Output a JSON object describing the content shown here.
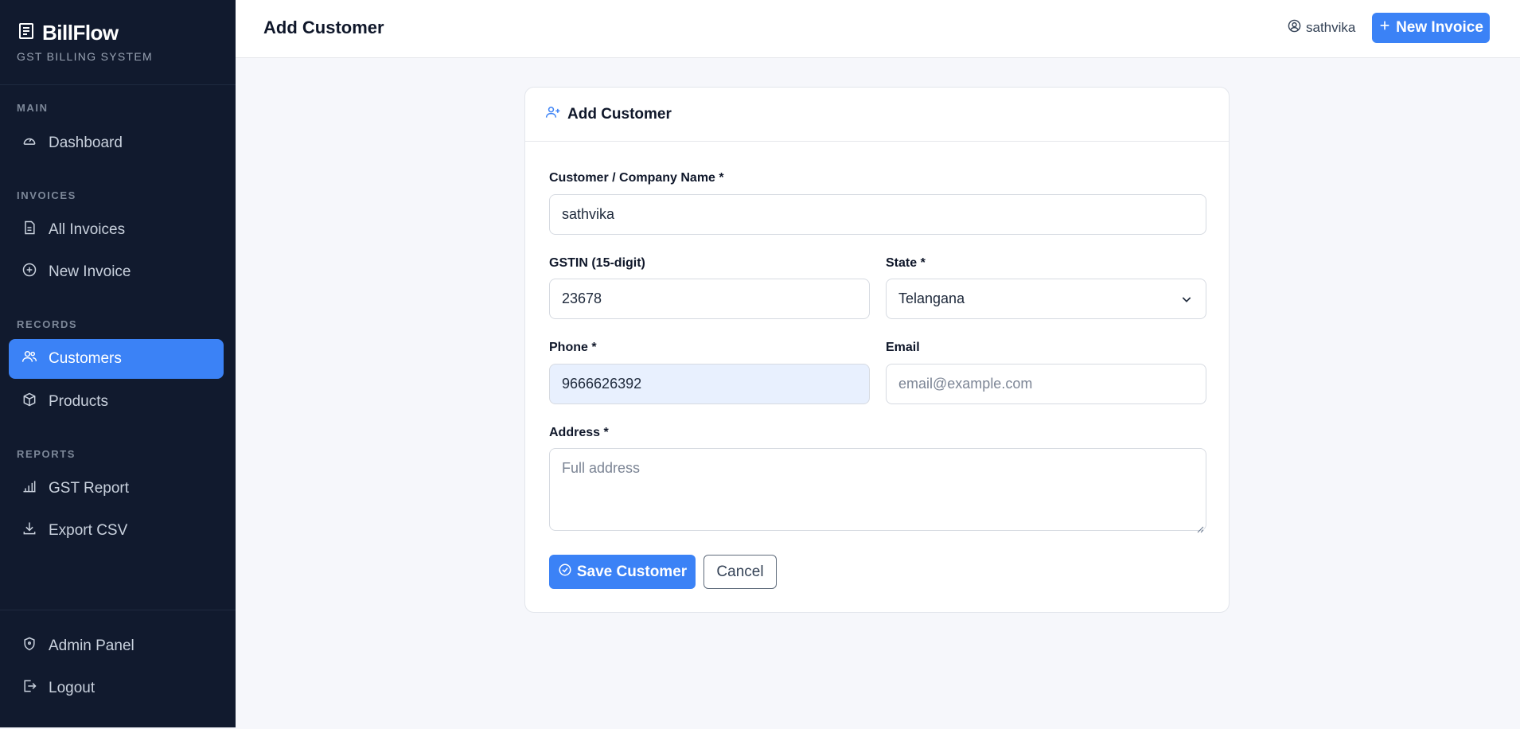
{
  "brand": {
    "title": "BillFlow",
    "subtitle": "GST BILLING SYSTEM"
  },
  "sidebar": {
    "sections": [
      "MAIN",
      "INVOICES",
      "RECORDS",
      "REPORTS"
    ],
    "items": [
      {
        "label": "Dashboard",
        "icon": "dashboard-gauge-icon"
      },
      {
        "label": "All Invoices",
        "icon": "document-icon"
      },
      {
        "label": "New Invoice",
        "icon": "plus-circle-icon"
      },
      {
        "label": "Customers",
        "icon": "users-icon",
        "active": true
      },
      {
        "label": "Products",
        "icon": "box-icon"
      },
      {
        "label": "GST Report",
        "icon": "bar-chart-icon"
      },
      {
        "label": "Export CSV",
        "icon": "download-icon"
      }
    ],
    "bottom_items": [
      {
        "label": "Admin Panel",
        "icon": "shield-icon"
      },
      {
        "label": "Logout",
        "icon": "logout-icon"
      }
    ]
  },
  "header": {
    "title": "Add Customer",
    "username": "sathvika",
    "new_invoice_label": "New Invoice"
  },
  "form": {
    "card_title": "Add Customer",
    "name": {
      "label": "Customer / Company Name *",
      "value": "sathvika"
    },
    "gstin": {
      "label": "GSTIN (15-digit)",
      "value": "23678"
    },
    "state": {
      "label": "State *",
      "value": "Telangana"
    },
    "phone": {
      "label": "Phone *",
      "value": "9666626392"
    },
    "email": {
      "label": "Email",
      "placeholder": "email@example.com"
    },
    "address": {
      "label": "Address *",
      "placeholder": "Full address"
    },
    "save_label": "Save Customer",
    "cancel_label": "Cancel"
  },
  "colors": {
    "sidebar_bg": "#111a2e",
    "accent": "#3b82f6",
    "page_bg": "#f6f7fb"
  }
}
